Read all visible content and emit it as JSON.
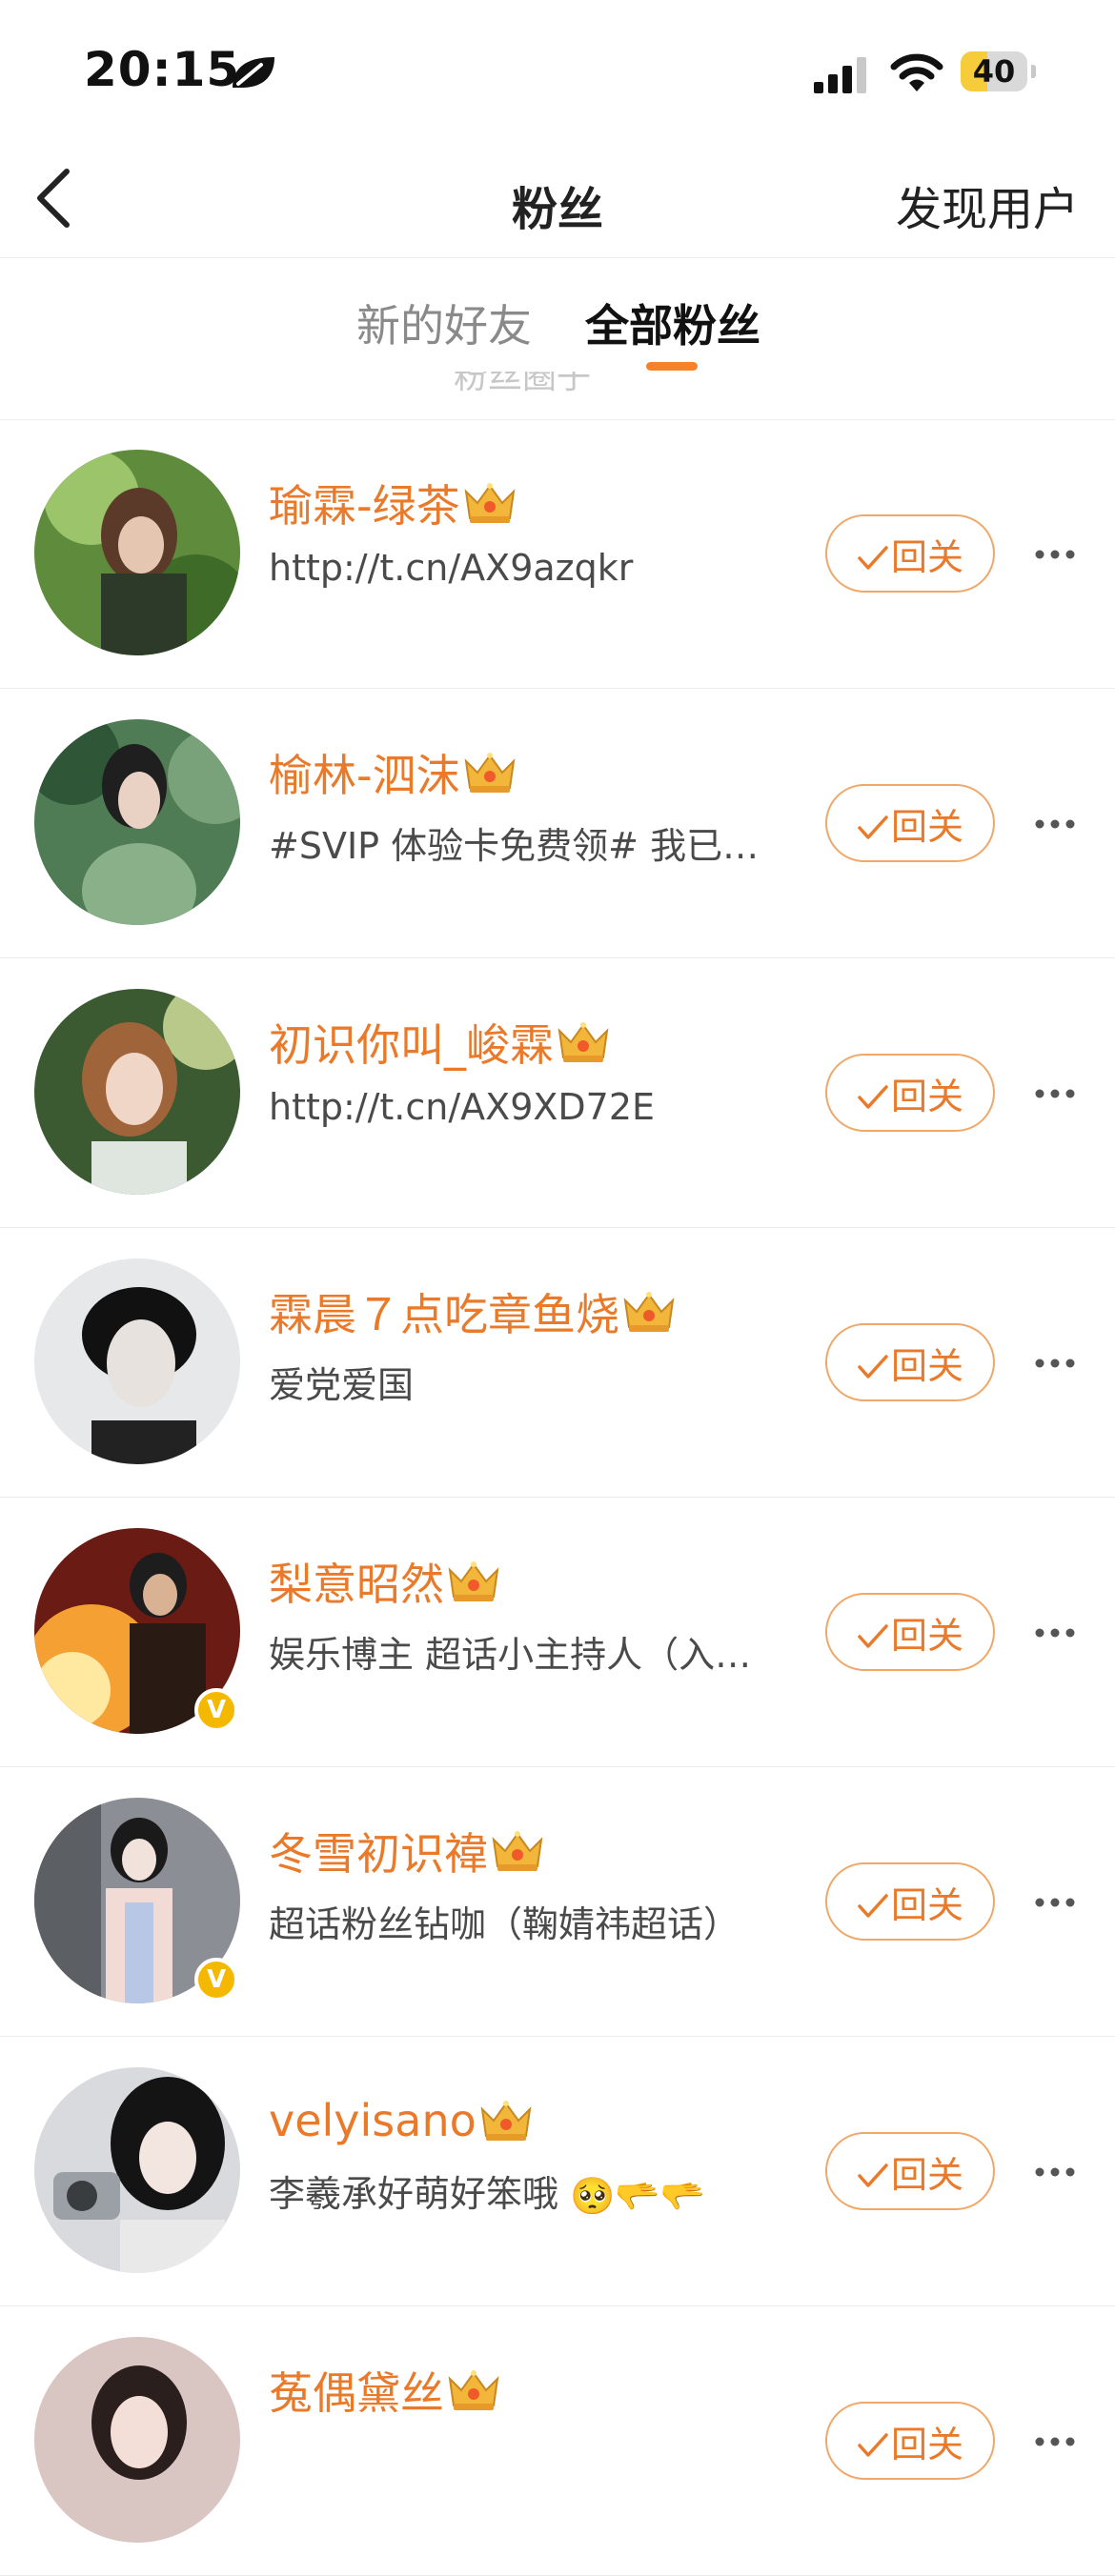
{
  "status_bar": {
    "time": "20:15",
    "battery": "40",
    "battery_level": 0.4
  },
  "nav": {
    "title": "粉丝",
    "right_link": "发现用户"
  },
  "tabs": {
    "items": [
      "新的好友",
      "全部粉丝"
    ],
    "active_index": 1,
    "partial_text": "粉丝圈子"
  },
  "colors": {
    "accent": "#ea7a2a",
    "indicator": "#f6822c",
    "verified": "#f5b800"
  },
  "follow_back_label": "回关",
  "fans": [
    {
      "name": "瑜霖-绿茶",
      "desc": "http://t.cn/AX9azqkr",
      "verified": false
    },
    {
      "name": "榆林-泗沫",
      "desc": "#SVIP 体验卡免费领# 我已成…",
      "verified": false
    },
    {
      "name": "初识你叫_峻霖",
      "desc": "http://t.cn/AX9XD72E",
      "verified": false
    },
    {
      "name": "霖晨７点吃章鱼烧",
      "desc": "爱党爱国",
      "verified": false
    },
    {
      "name": "梨意昭然",
      "desc": "娱乐博主 超话小主持人（入青…",
      "verified": true
    },
    {
      "name": "冬雪初识禕",
      "desc": "超话粉丝钻咖（鞠婧祎超话）",
      "verified": true
    },
    {
      "name": "velyisano",
      "desc": "李羲承好萌好笨哦",
      "desc_emoji": "🥺🫳🫳",
      "verified": false
    },
    {
      "name": "菟偶黛丝",
      "desc": "",
      "verified": false
    }
  ]
}
